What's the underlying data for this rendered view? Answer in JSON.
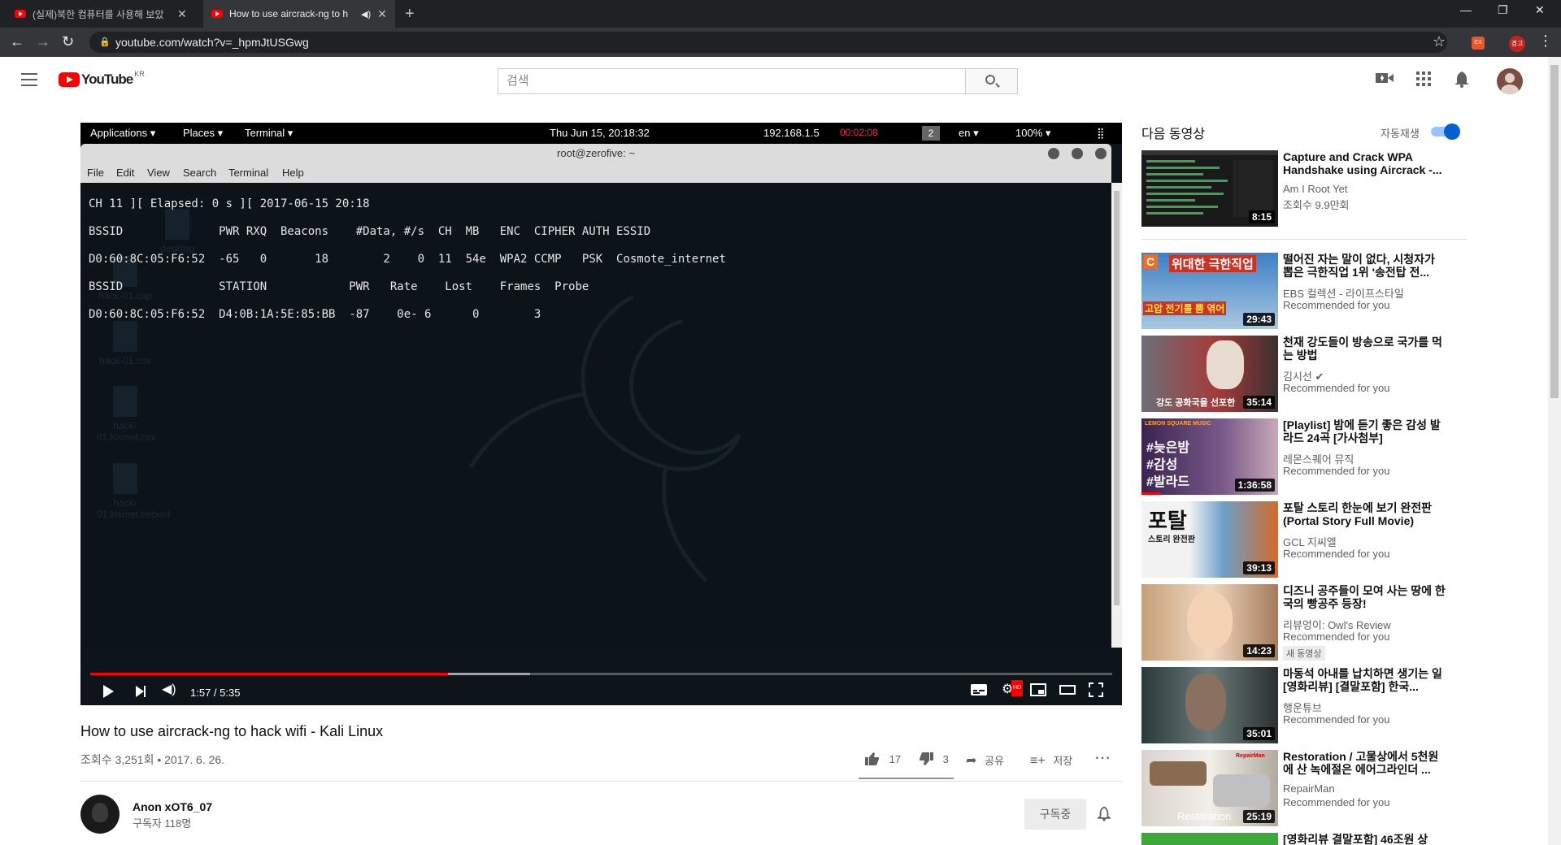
{
  "browser": {
    "tabs": [
      {
        "title": "(실제)북한 컴퓨터를 사용해 보았",
        "active": false
      },
      {
        "title": "How to use aircrack-ng to h",
        "active": true
      }
    ],
    "url": "youtube.com/watch?v=_hpmJtUSGwg",
    "ext_label": "경고"
  },
  "youtube": {
    "logo_text": "YouTube",
    "region": "KR",
    "search_placeholder": "검색"
  },
  "kali": {
    "menu": [
      "Applications ▾",
      "Places ▾",
      "Terminal ▾"
    ],
    "clock": "Thu Jun 15, 20:18:32",
    "ip": "192.168.1.5",
    "rec_time": "00:02:08",
    "workspace": "2",
    "lang": "en ▾",
    "battery": "100% ▾",
    "terminal_title": "root@zerofive: ~",
    "terminal_menu": [
      "File",
      "Edit",
      "View",
      "Search",
      "Terminal",
      "Help"
    ],
    "terminal_lines": [
      "CH 11 ][ Elapsed: 0 s ][ 2017-06-15 20:18",
      "BSSID              PWR RXQ  Beacons    #Data, #/s  CH  MB   ENC  CIPHER AUTH ESSID",
      "D0:60:8C:05:F6:52  -65   0       18        2    0  11  54e  WPA2 CCMP   PSK  Cosmote_internet",
      "BSSID              STATION            PWR   Rate    Lost    Frames  Probe",
      "D0:60:8C:05:F6:52  D4:0B:1A:5E:85:BB  -87    0e- 6      0        3"
    ],
    "desktop_icons": [
      "desktop",
      "hack-01.cap",
      "hack-01.csv",
      "hack-01.kismet.csv",
      "hack-01.kismet.netxml"
    ]
  },
  "player": {
    "time": "1:57 / 5:35",
    "progress": 0.35,
    "buffered": 0.43
  },
  "video": {
    "title": "How to use aircrack-ng to hack wifi - Kali Linux",
    "meta": "조회수 3,251회 • 2017. 6. 26.",
    "likes": "17",
    "dislikes": "3",
    "share": "공유",
    "save": "저장",
    "channel": "Anon xOT6_07",
    "subscribers": "구독자 118명",
    "subscribe_label": "구독중"
  },
  "sidebar": {
    "up_next": "다음 동영상",
    "autoplay": "자동재생",
    "items": [
      {
        "title": "Capture and Crack WPA Handshake using Aircrack -...",
        "channel": "Am I Root Yet",
        "info": "조회수 9.9만회",
        "duration": "8:15",
        "badge": ""
      },
      {
        "title": "떨어진 자는 말이 없다, 시청자가 뽑은 극한직업 1위 '송전탑 전...",
        "channel": "EBS 컬렉션 - 라이프스타일",
        "info": "Recommended for you",
        "duration": "29:43",
        "badge": ""
      },
      {
        "title": "천재 강도들이 방송으로 국가를 먹는 방법",
        "channel": "김시선 ✔",
        "info": "Recommended for you",
        "duration": "35:14",
        "badge": ""
      },
      {
        "title": "[Playlist] 밤에 듣기 좋은 감성 발라드 24곡 [가사첨부]",
        "channel": "레몬스퀘어 뮤직",
        "info": "Recommended for you",
        "duration": "1:36:58",
        "badge": ""
      },
      {
        "title": "포탈 스토리 한눈에 보기 완전판 (Portal Story Full Movie)",
        "channel": "GCL 지씨엘",
        "info": "Recommended for you",
        "duration": "39:13",
        "badge": ""
      },
      {
        "title": "디즈니 공주들이 모여 사는 땅에 한국의 빵공주 등장!",
        "channel": "리뷰엉이: Owl's Review",
        "info": "Recommended for you",
        "duration": "14:23",
        "badge": "새 동영상"
      },
      {
        "title": "마동석 아내를 납치하면 생기는 일 [영화리뷰] [결말포함] 한국...",
        "channel": "행운튜브",
        "info": "Recommended for you",
        "duration": "35:01",
        "badge": ""
      },
      {
        "title": "Restoration / 고물상에서 5천원에 산 녹에절은 에어그라인더 ...",
        "channel": "RepairMan",
        "info": "Recommended for you",
        "duration": "25:19",
        "badge": ""
      },
      {
        "title": "[영화리뷰 결말포함] 46조원 상",
        "channel": "",
        "info": "",
        "duration": "",
        "badge": ""
      }
    ],
    "thumb_texts": {
      "t2a": "위대한 극한직업",
      "t2b": "고압 전기를 뿜 엮어",
      "t3": "강도 공화국을 선포한",
      "t4a": "LEMON SQUARE MUSIC",
      "t4b": "#늦은밤",
      "t4c": "#감성",
      "t4d": "#발라드",
      "t5": "포탈",
      "t5b": "스토리 완전판",
      "t8a": "RepairMan",
      "t8b": "Restoration"
    }
  },
  "colors": {
    "accent": "#ff0000",
    "link_blue": "#065fd4"
  }
}
